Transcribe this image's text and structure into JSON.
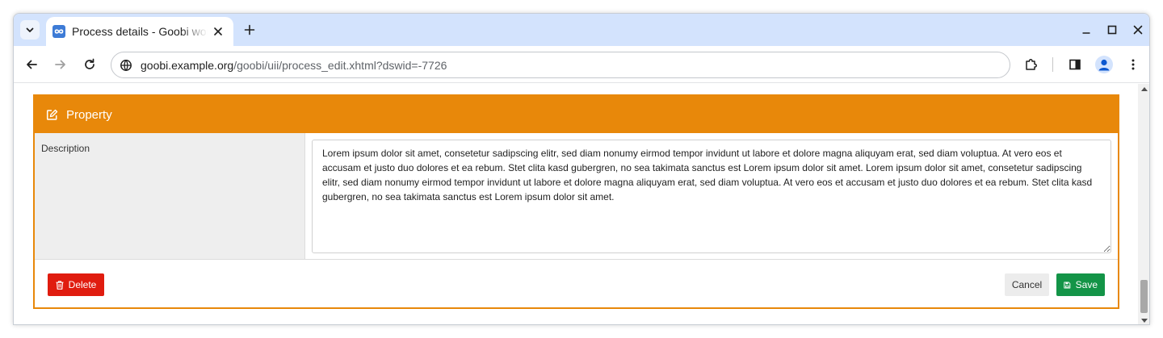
{
  "browser": {
    "tab": {
      "title": "Process details - Goobi workflow"
    },
    "address_bar": {
      "url_host": "goobi.example.org",
      "url_path": "/goobi/uii/process_edit.xhtml?dswid=-7726"
    }
  },
  "panel": {
    "title": "Property",
    "rows": [
      {
        "label": "Description",
        "value": "Lorem ipsum dolor sit amet, consetetur sadipscing elitr, sed diam nonumy eirmod tempor invidunt ut labore et dolore magna aliquyam erat, sed diam voluptua. At vero eos et accusam et justo duo dolores et ea rebum. Stet clita kasd gubergren, no sea takimata sanctus est Lorem ipsum dolor sit amet. Lorem ipsum dolor sit amet, consetetur sadipscing elitr, sed diam nonumy eirmod tempor invidunt ut labore et dolore magna aliquyam erat, sed diam voluptua. At vero eos et accusam et justo duo dolores et ea rebum. Stet clita kasd gubergren, no sea takimata sanctus est Lorem ipsum dolor sit amet."
      }
    ],
    "buttons": {
      "delete": "Delete",
      "cancel": "Cancel",
      "save": "Save"
    }
  },
  "icons": {
    "tab_search": "chevron-down-icon",
    "favicon": "infinity-icon",
    "tab_close": "close-icon",
    "new_tab": "plus-icon",
    "minimize": "minimize-icon",
    "maximize": "maximize-icon",
    "close_window": "close-icon",
    "back": "arrow-left-icon",
    "forward": "arrow-right-icon",
    "reload": "reload-icon",
    "site_info": "site-info-icon",
    "extensions": "puzzle-icon",
    "side_panel": "side-panel-icon",
    "profile": "profile-icon",
    "menu": "kebab-menu-icon",
    "panel_header": "edit-icon",
    "delete": "trash-icon",
    "save": "floppy-disk-icon"
  },
  "colors": {
    "tabstrip": "#d3e3fd",
    "panel_accent": "#e8880a",
    "delete_button": "#e01c0f",
    "save_button": "#139447",
    "cancel_button": "#ececec"
  }
}
